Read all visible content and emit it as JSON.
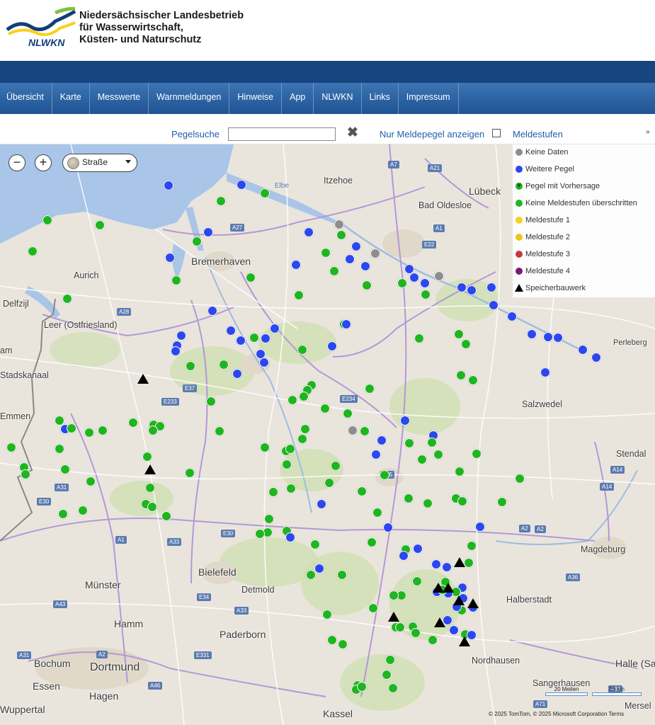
{
  "header": {
    "org_line1": "Niedersächsischer  Landesbetrieb",
    "org_line2": "für Wasserwirtschaft,",
    "org_line3": "Küsten- und Naturschutz",
    "logo_text": "NLWKN",
    "logo_colors": {
      "navy": "#123e7a",
      "yellow": "#f6d31b",
      "green": "#7cc242"
    }
  },
  "nav": {
    "items": [
      {
        "label": "Übersicht"
      },
      {
        "label": "Karte"
      },
      {
        "label": "Messwerte"
      },
      {
        "label": "Warnmeldungen"
      },
      {
        "label": "Hinweise"
      },
      {
        "label": "App"
      },
      {
        "label": "NLWKN"
      },
      {
        "label": "Links"
      },
      {
        "label": "Impressum"
      }
    ]
  },
  "toolbar": {
    "search_label": "Pegelsuche",
    "search_value": "",
    "clear_icon": "close-x-icon",
    "only_meldepegel_label": "Nur Meldepegel anzeigen",
    "only_meldepegel_checked": false,
    "meldestufen_label": "Meldestufen",
    "collapse_icon": "double-chevron-down-icon"
  },
  "map_controls": {
    "zoom_out": "−",
    "zoom_in": "+",
    "style_selected": "Straße"
  },
  "legend": {
    "items": [
      {
        "label": "Keine Daten",
        "color": "#8d8d8d",
        "shape": "dot"
      },
      {
        "label": "Weitere Pegel",
        "color": "#2b47f0",
        "shape": "dot"
      },
      {
        "label": "Pegel mit Vorhersage",
        "color": "#1fb51f",
        "shape": "dot-v",
        "mark": "V"
      },
      {
        "label": "Keine Meldestufen überschritten",
        "color": "#1fb51f",
        "shape": "dot"
      },
      {
        "label": "Meldestufe 1",
        "color": "#f4d21c",
        "shape": "dot"
      },
      {
        "label": "Meldestufe 2",
        "color": "#f2c21a",
        "shape": "dot"
      },
      {
        "label": "Meldestufe 3",
        "color": "#c43a3a",
        "shape": "dot"
      },
      {
        "label": "Meldestufe 4",
        "color": "#7b1a7b",
        "shape": "dot"
      },
      {
        "label": "Speicherbauwerk",
        "color": "#000000",
        "shape": "triangle"
      }
    ]
  },
  "places": {
    "itzehoe": "Itzehoe",
    "luebeck": "Lübeck",
    "bad_oldesloe": "Bad Oldesloe",
    "bremerhaven": "Bremerhaven",
    "aurich": "Aurich",
    "delfzijl": "Delfzijl",
    "leer": "Leer (Ostfriesland)",
    "stadskanaal": "Stadskanaal",
    "emmen": "Emmen",
    "salzwedel": "Salzwedel",
    "perleberg": "Perleberg",
    "stendal": "Stendal",
    "magdeburg": "Magdeburg",
    "bielefeld": "Bielefeld",
    "detmold": "Detmold",
    "muenster": "Münster",
    "hamm": "Hamm",
    "paderborn": "Paderborn",
    "halberstadt": "Halberstadt",
    "nordhausen": "Nordhausen",
    "bochum": "Bochum",
    "dortmund": "Dortmund",
    "essen": "Essen",
    "hagen": "Hagen",
    "wuppertal": "Wuppertal",
    "kassel": "Kassel",
    "sangerhausen": "Sangerhausen",
    "halle": "Halle (Sa",
    "merseburg": "Mersel",
    "elbe": "Elbe",
    "am": "am"
  },
  "roads": [
    "A7",
    "A21",
    "A27",
    "A1",
    "E22",
    "A28",
    "E37",
    "E233",
    "E234",
    "E45",
    "A31",
    "E30",
    "A1",
    "A33",
    "A2",
    "E30",
    "E34",
    "A33",
    "A43",
    "E331",
    "A2",
    "A31",
    "A46",
    "A14",
    "A14",
    "A2",
    "A36",
    "A71",
    "A38"
  ],
  "scale": {
    "miles": "20 Meilen",
    "km": "25 km"
  },
  "copyright": "© 2025 TomTom, © 2025 Microsoft Corporation   Terms"
}
